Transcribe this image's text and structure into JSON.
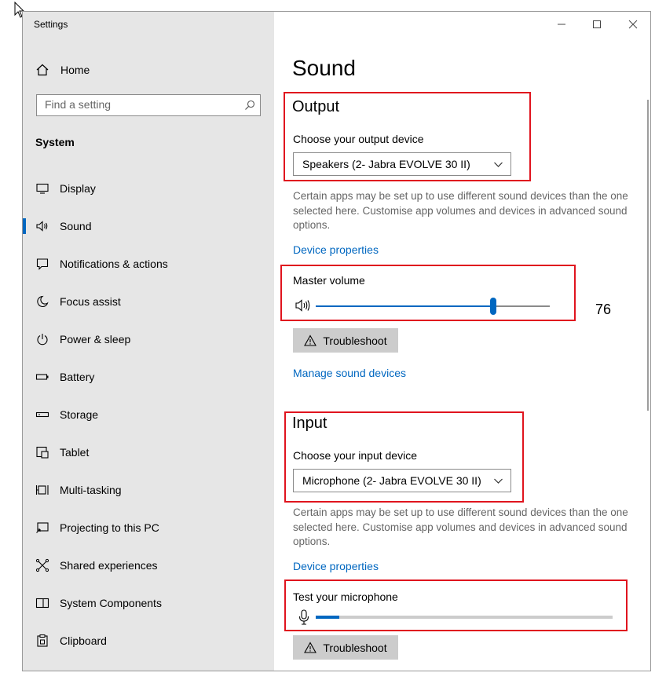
{
  "window": {
    "app_title": "Settings",
    "controls": {
      "minimize": "—",
      "maximize": "☐",
      "close": "✕"
    }
  },
  "sidebar": {
    "home_label": "Home",
    "search": {
      "placeholder": "Find a setting"
    },
    "section": "System",
    "items": [
      {
        "label": "Display",
        "icon": "display-icon"
      },
      {
        "label": "Sound",
        "icon": "speaker-icon",
        "active": true
      },
      {
        "label": "Notifications & actions",
        "icon": "notifications-icon"
      },
      {
        "label": "Focus assist",
        "icon": "moon-icon"
      },
      {
        "label": "Power & sleep",
        "icon": "power-icon"
      },
      {
        "label": "Battery",
        "icon": "battery-icon"
      },
      {
        "label": "Storage",
        "icon": "storage-icon"
      },
      {
        "label": "Tablet",
        "icon": "tablet-icon"
      },
      {
        "label": "Multi-tasking",
        "icon": "multitasking-icon"
      },
      {
        "label": "Projecting to this PC",
        "icon": "projecting-icon"
      },
      {
        "label": "Shared experiences",
        "icon": "shared-icon"
      },
      {
        "label": "System Components",
        "icon": "components-icon"
      },
      {
        "label": "Clipboard",
        "icon": "clipboard-icon"
      }
    ]
  },
  "main": {
    "title": "Sound",
    "output": {
      "heading": "Output",
      "choose_label": "Choose your output device",
      "device": "Speakers (2- Jabra EVOLVE 30 II)",
      "description": "Certain apps may be set up to use different sound devices than the one selected here. Customise app volumes and devices in advanced sound options.",
      "device_properties": "Device properties",
      "master_volume_label": "Master volume",
      "volume_value": "76",
      "volume_level": 76,
      "troubleshoot": "Troubleshoot",
      "manage_devices": "Manage sound devices"
    },
    "input": {
      "heading": "Input",
      "choose_label": "Choose your input device",
      "device": "Microphone (2- Jabra EVOLVE 30 II)",
      "description": "Certain apps may be set up to use different sound devices than the one selected here. Customise app volumes and devices in advanced sound options.",
      "device_properties": "Device properties",
      "test_label": "Test your microphone",
      "mic_level": 8,
      "troubleshoot": "Troubleshoot"
    }
  },
  "colors": {
    "accent": "#0067c0",
    "highlight_box": "#e0141e",
    "sidebar_bg": "#e6e6e6"
  }
}
